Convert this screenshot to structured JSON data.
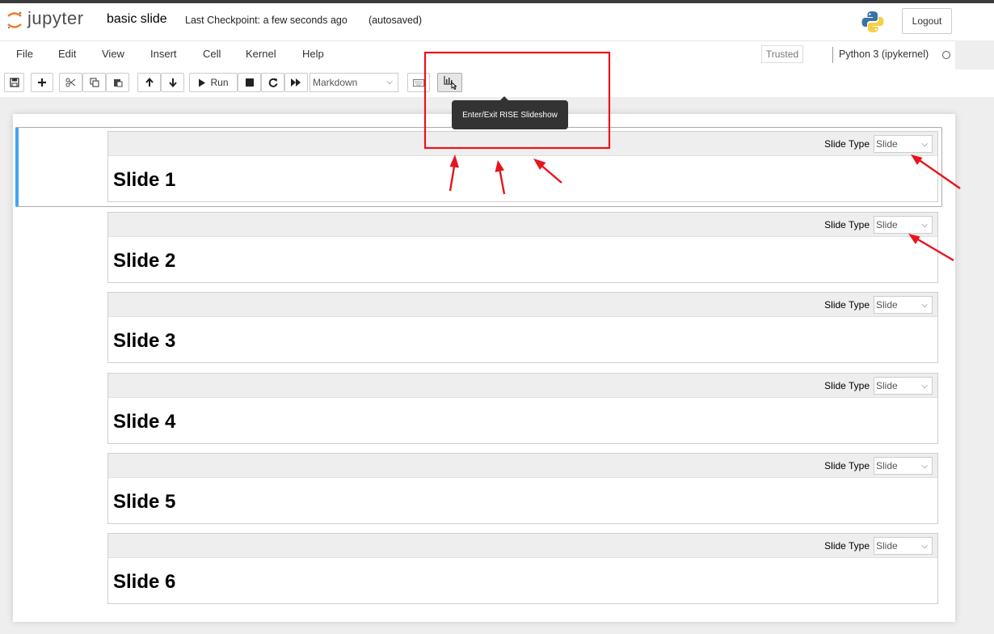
{
  "header": {
    "logo_text": "jupyter",
    "notebook_name": "basic slide",
    "checkpoint": "Last Checkpoint: a few seconds ago",
    "autosave": "(autosaved)",
    "logout_label": "Logout"
  },
  "menu": {
    "items": [
      "File",
      "Edit",
      "View",
      "Insert",
      "Cell",
      "Kernel",
      "Help"
    ],
    "trusted": "Trusted",
    "kernel": "Python 3 (ipykernel)"
  },
  "toolbar": {
    "run_label": "Run",
    "cell_type": "Markdown",
    "tooltip": "Enter/Exit RISE Slideshow"
  },
  "cells": [
    {
      "slide_type_label": "Slide Type",
      "slide_type": "Slide",
      "heading": "Slide 1"
    },
    {
      "slide_type_label": "Slide Type",
      "slide_type": "Slide",
      "heading": "Slide 2"
    },
    {
      "slide_type_label": "Slide Type",
      "slide_type": "Slide",
      "heading": "Slide 3"
    },
    {
      "slide_type_label": "Slide Type",
      "slide_type": "Slide",
      "heading": "Slide 4"
    },
    {
      "slide_type_label": "Slide Type",
      "slide_type": "Slide",
      "heading": "Slide 5"
    },
    {
      "slide_type_label": "Slide Type",
      "slide_type": "Slide",
      "heading": "Slide 6"
    }
  ],
  "colors": {
    "selection": "#42a5f5",
    "annotation": "#e8141c",
    "tooltip_bg": "#333333",
    "logo_orange": "#f37726"
  },
  "icons": [
    "save-icon",
    "plus-icon",
    "scissors-icon",
    "copy-icon",
    "paste-icon",
    "arrow-up-icon",
    "arrow-down-icon",
    "play-icon",
    "stop-icon",
    "restart-icon",
    "fast-forward-icon",
    "keyboard-icon",
    "bar-chart-icon"
  ]
}
